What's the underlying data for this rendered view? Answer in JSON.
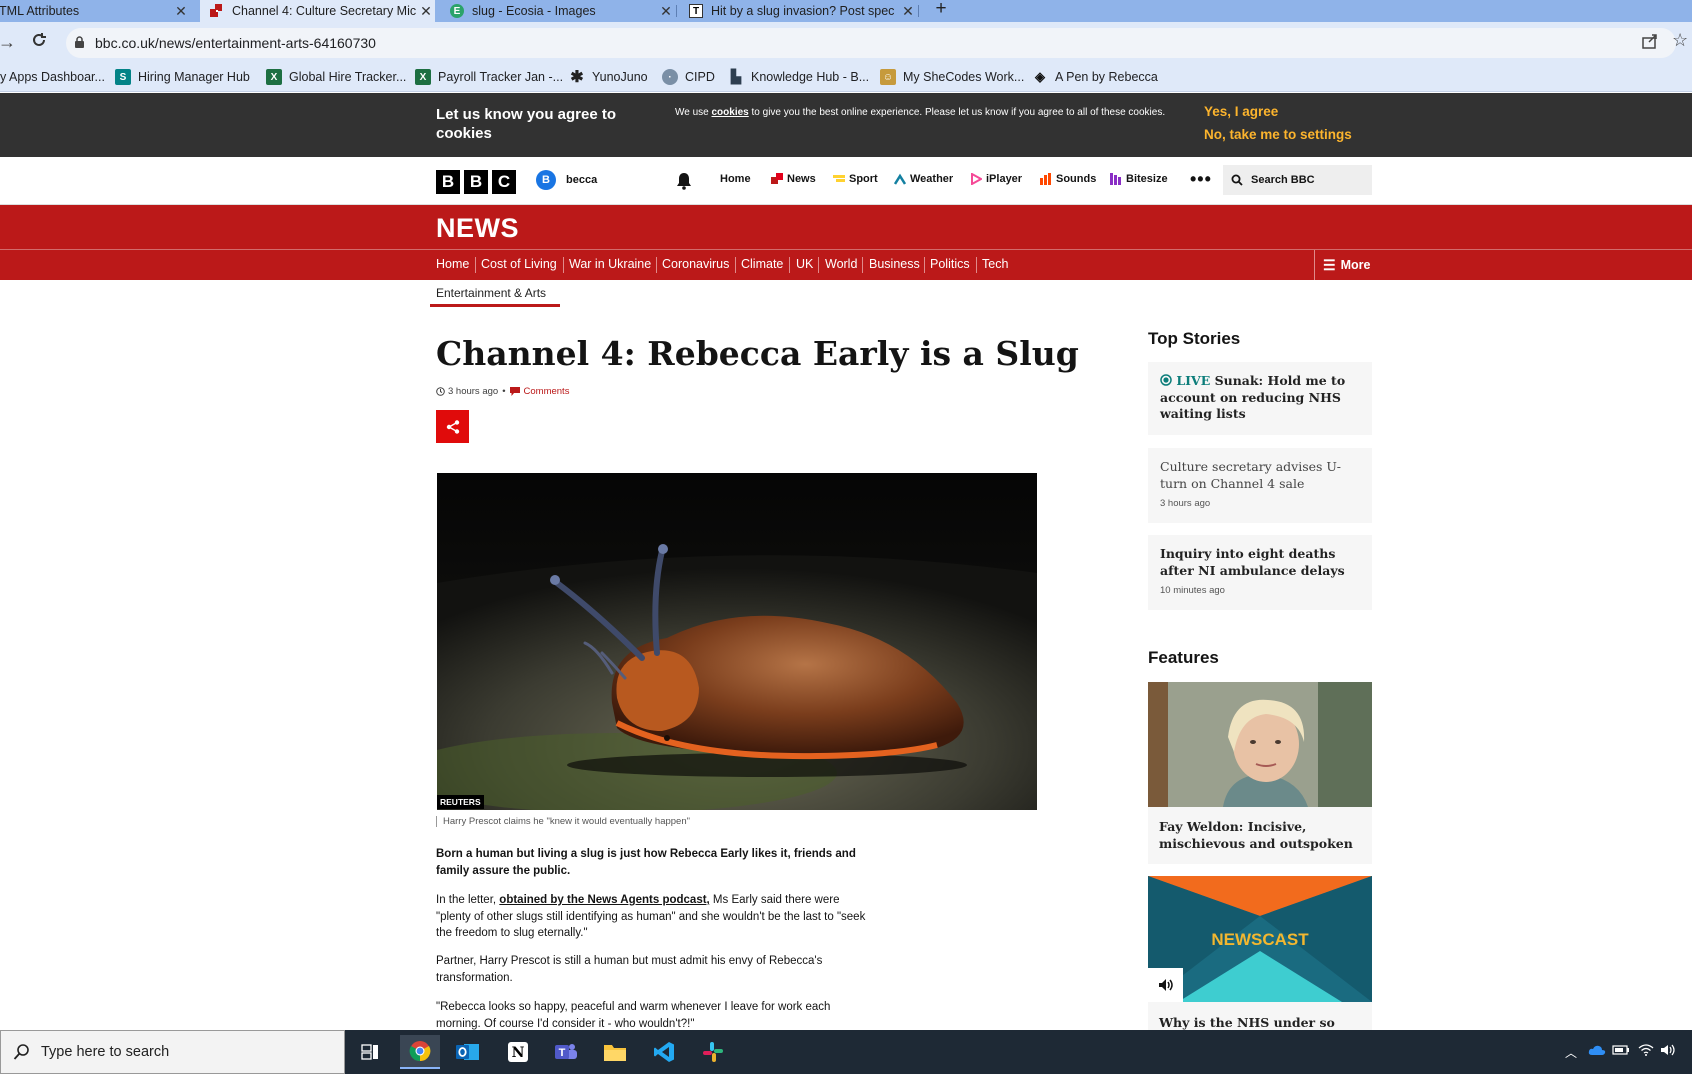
{
  "browser": {
    "tabs": [
      {
        "title": "HTML Attributes",
        "favicon": "html-page-icon"
      },
      {
        "title": "Channel 4: Culture Secretary Mic",
        "favicon": "bbc-news-icon"
      },
      {
        "title": "slug - Ecosia - Images",
        "favicon": "ecosia-icon"
      },
      {
        "title": "Hit by a slug invasion? Post spec",
        "favicon": "telegraph-icon"
      }
    ],
    "active_tab": 1,
    "url": "bbc.co.uk/news/entertainment-arts-64160730",
    "bookmarks": [
      {
        "label": "y Apps Dashboar...",
        "icon": "apps-icon",
        "color": "#5f6368"
      },
      {
        "label": "Hiring Manager Hub",
        "icon": "sharepoint-icon",
        "color": "#038387"
      },
      {
        "label": "Global Hire Tracker...",
        "icon": "excel-icon",
        "color": "#1d6f42"
      },
      {
        "label": "Payroll Tracker Jan -...",
        "icon": "excel-icon",
        "color": "#1d6f42"
      },
      {
        "label": "YunoJuno",
        "icon": "asterisk-icon",
        "color": "#222222"
      },
      {
        "label": "CIPD",
        "icon": "cipd-icon",
        "color": "#7a8fa6"
      },
      {
        "label": "Knowledge Hub - B...",
        "icon": "flag-icon",
        "color": "#2d3e50"
      },
      {
        "label": "My SheCodes Work...",
        "icon": "shecodes-icon",
        "color": "#c69a3c"
      },
      {
        "label": "A Pen by Rebecca",
        "icon": "codepen-icon",
        "color": "#111111"
      }
    ]
  },
  "cookie_banner": {
    "title": "Let us know you agree to cookies",
    "text_before": "We use ",
    "text_link": "cookies",
    "text_after": " to give you the best online experience. Please let us know if you agree to all of these cookies.",
    "agree": "Yes, I agree",
    "settings": "No, take me to settings"
  },
  "global_nav": {
    "logo": [
      "B",
      "B",
      "C"
    ],
    "account_initial": "B",
    "account_name": "becca",
    "items": [
      {
        "label": "Home",
        "icon": ""
      },
      {
        "label": "News",
        "icon": "news-icon"
      },
      {
        "label": "Sport",
        "icon": "sport-icon"
      },
      {
        "label": "Weather",
        "icon": "weather-icon"
      },
      {
        "label": "iPlayer",
        "icon": "iplayer-icon"
      },
      {
        "label": "Sounds",
        "icon": "sounds-icon"
      },
      {
        "label": "Bitesize",
        "icon": "bitesize-icon"
      }
    ],
    "more": "•••",
    "search": "Search BBC"
  },
  "news_header": {
    "logo": "NEWS",
    "nav": [
      "Home",
      "Cost of Living",
      "War in Ukraine",
      "Coronavirus",
      "Climate",
      "UK",
      "World",
      "Business",
      "Politics",
      "Tech"
    ],
    "more": "More",
    "section": "Entertainment & Arts"
  },
  "article": {
    "headline": "Channel 4: Rebecca Early is a Slug",
    "time": "3 hours ago",
    "comments": "Comments",
    "image_credit": "REUTERS",
    "caption": "Harry Prescot claims he \"knew it would eventually happen\"",
    "intro": "Born a human but living a slug is just how Rebecca Early likes it, friends and family assure the public.",
    "p2_before": "In the letter, ",
    "p2_link": "obtained by the News Agents podcast,",
    "p2_after": " Ms Early said there were \"plenty of other slugs still identifying as human\" and she wouldn't be the last to \"seek the freedom to slug eternally.\"",
    "p3": "Partner, Harry Prescot is still a human but must admit his envy of Rebecca's transformation.",
    "p4": "\"Rebecca looks so happy, peaceful and warm whenever I leave for work each morning. Of course I'd consider it - who wouldn't?!\""
  },
  "sidebar": {
    "top_stories_heading": "Top Stories",
    "stories": [
      {
        "live": "LIVE",
        "title": "Sunak: Hold me to account on reducing NHS waiting lists",
        "time": ""
      },
      {
        "live": "",
        "title": "Culture secretary advises U-turn on Channel 4 sale",
        "time": "3 hours ago"
      },
      {
        "live": "",
        "title": "Inquiry into eight deaths after NI ambulance delays",
        "time": "10 minutes ago"
      }
    ],
    "features_heading": "Features",
    "features": [
      {
        "title": "Fay Weldon: Incisive, mischievous and outspoken"
      },
      {
        "title": "Why is the NHS under so",
        "image_text": "NEWSCAST"
      }
    ]
  },
  "taskbar": {
    "search_placeholder": "Type here to search",
    "apps": [
      "task-view-icon",
      "chrome-icon",
      "outlook-icon",
      "notion-icon",
      "teams-icon",
      "file-explorer-icon",
      "vscode-icon",
      "slack-icon"
    ]
  }
}
